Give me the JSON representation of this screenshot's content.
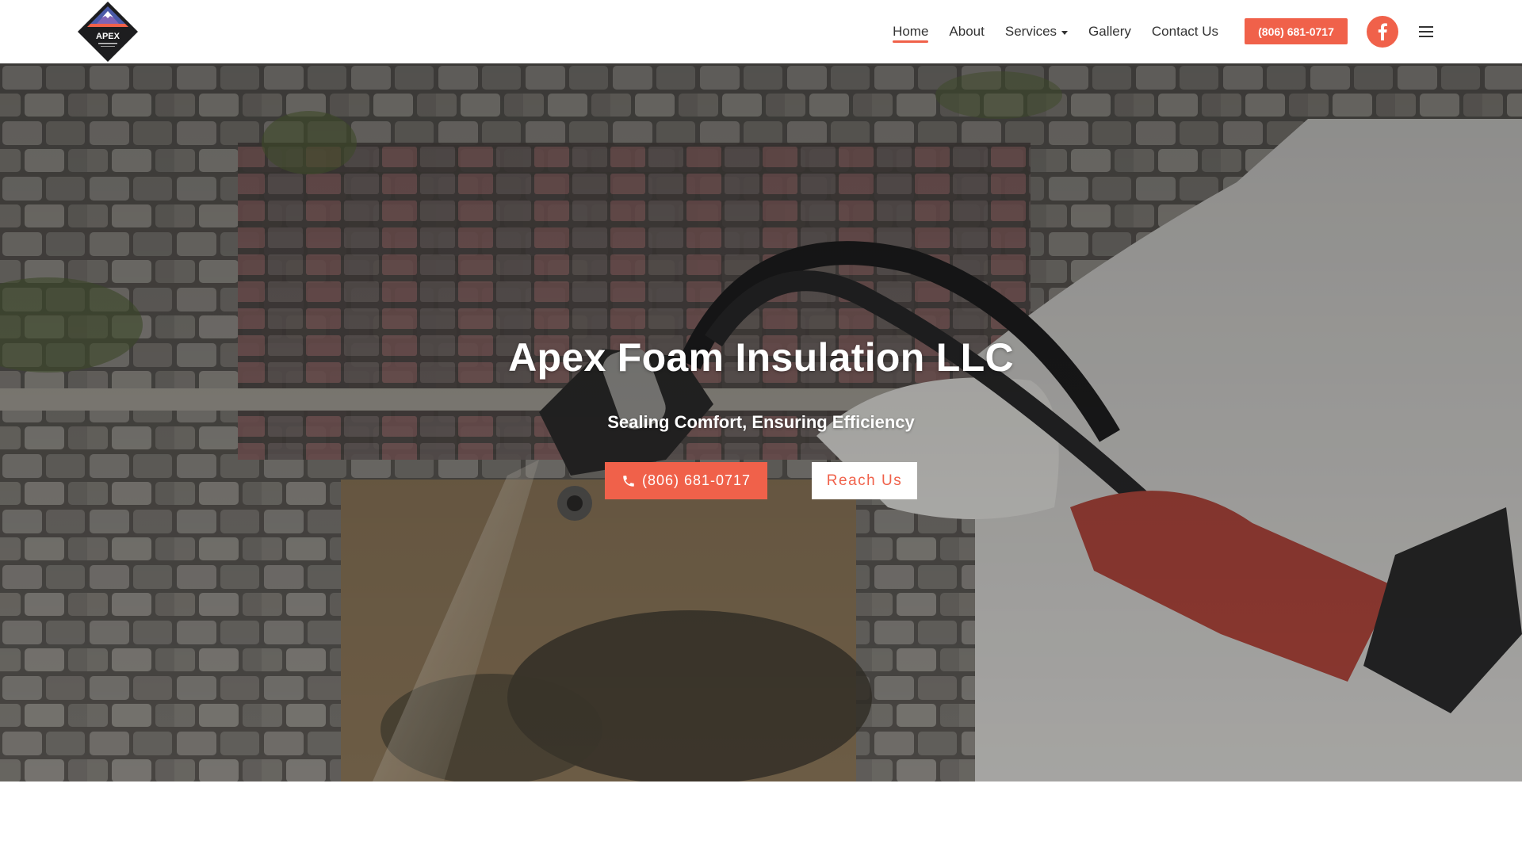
{
  "brand": {
    "logo_alt": "APEX",
    "accent_color": "#f0614a"
  },
  "nav": {
    "items": [
      {
        "label": "Home",
        "active": true
      },
      {
        "label": "About"
      },
      {
        "label": "Services",
        "has_dropdown": true
      },
      {
        "label": "Gallery"
      },
      {
        "label": "Contact Us"
      }
    ],
    "phone_label": "(806) 681-0717",
    "social_icon": "facebook-icon",
    "menu_icon": "hamburger-menu-icon"
  },
  "hero": {
    "title": "Apex Foam Insulation LLC",
    "subtitle": "Sealing Comfort, Ensuring Efficiency",
    "call_label": "(806) 681-0717",
    "call_icon": "phone-icon",
    "reach_label": "Reach Us"
  }
}
